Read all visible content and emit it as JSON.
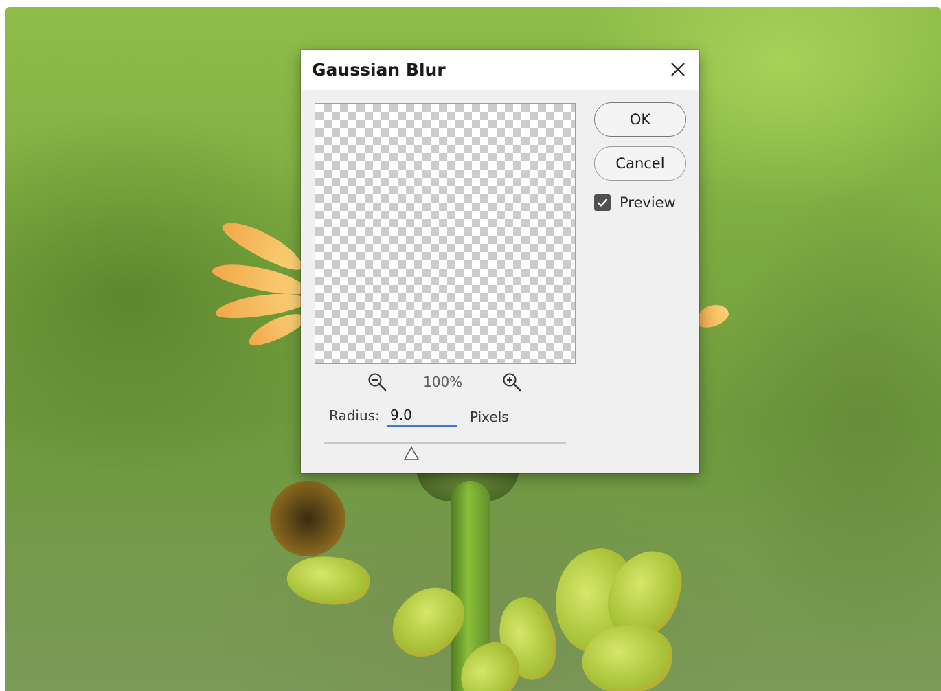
{
  "dialog": {
    "title": "Gaussian Blur",
    "buttons": {
      "ok_label": "OK",
      "cancel_label": "Cancel"
    },
    "preview_checkbox": {
      "label": "Preview",
      "checked": true
    },
    "zoom": {
      "level": "100%",
      "zoom_out_icon": "zoom-out-magnifier",
      "zoom_in_icon": "zoom-in-magnifier"
    },
    "radius": {
      "label": "Radius:",
      "value": "9.0",
      "units": "Pixels",
      "slider_fraction": 0.36
    },
    "close_icon": "close-x"
  },
  "colors": {
    "dialog_bg": "#f0f0f0",
    "titlebar_bg": "#ffffff",
    "input_underline": "#3b78d8",
    "checkbox_fill": "#505050"
  }
}
